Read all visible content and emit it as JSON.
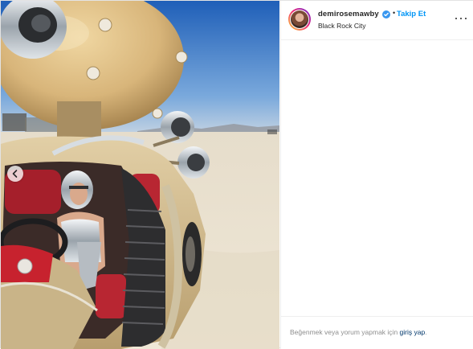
{
  "post": {
    "username": "demirosemawby",
    "follow_label": "Takip Et",
    "separator": "•",
    "location": "Black Rock City",
    "verified": true
  },
  "icons": {
    "verified": "verified-badge-icon",
    "more": "more-options-icon",
    "carousel": "carousel-previous-icon"
  },
  "footer": {
    "prompt_text": "Beğenmek veya yorum yapmak için ",
    "login_link": "giriş yap",
    "suffix": "."
  },
  "colors": {
    "link_blue": "#0095f6",
    "dark_text": "#262626",
    "muted_text": "#8e8e8e",
    "login_link": "#00376b"
  }
}
